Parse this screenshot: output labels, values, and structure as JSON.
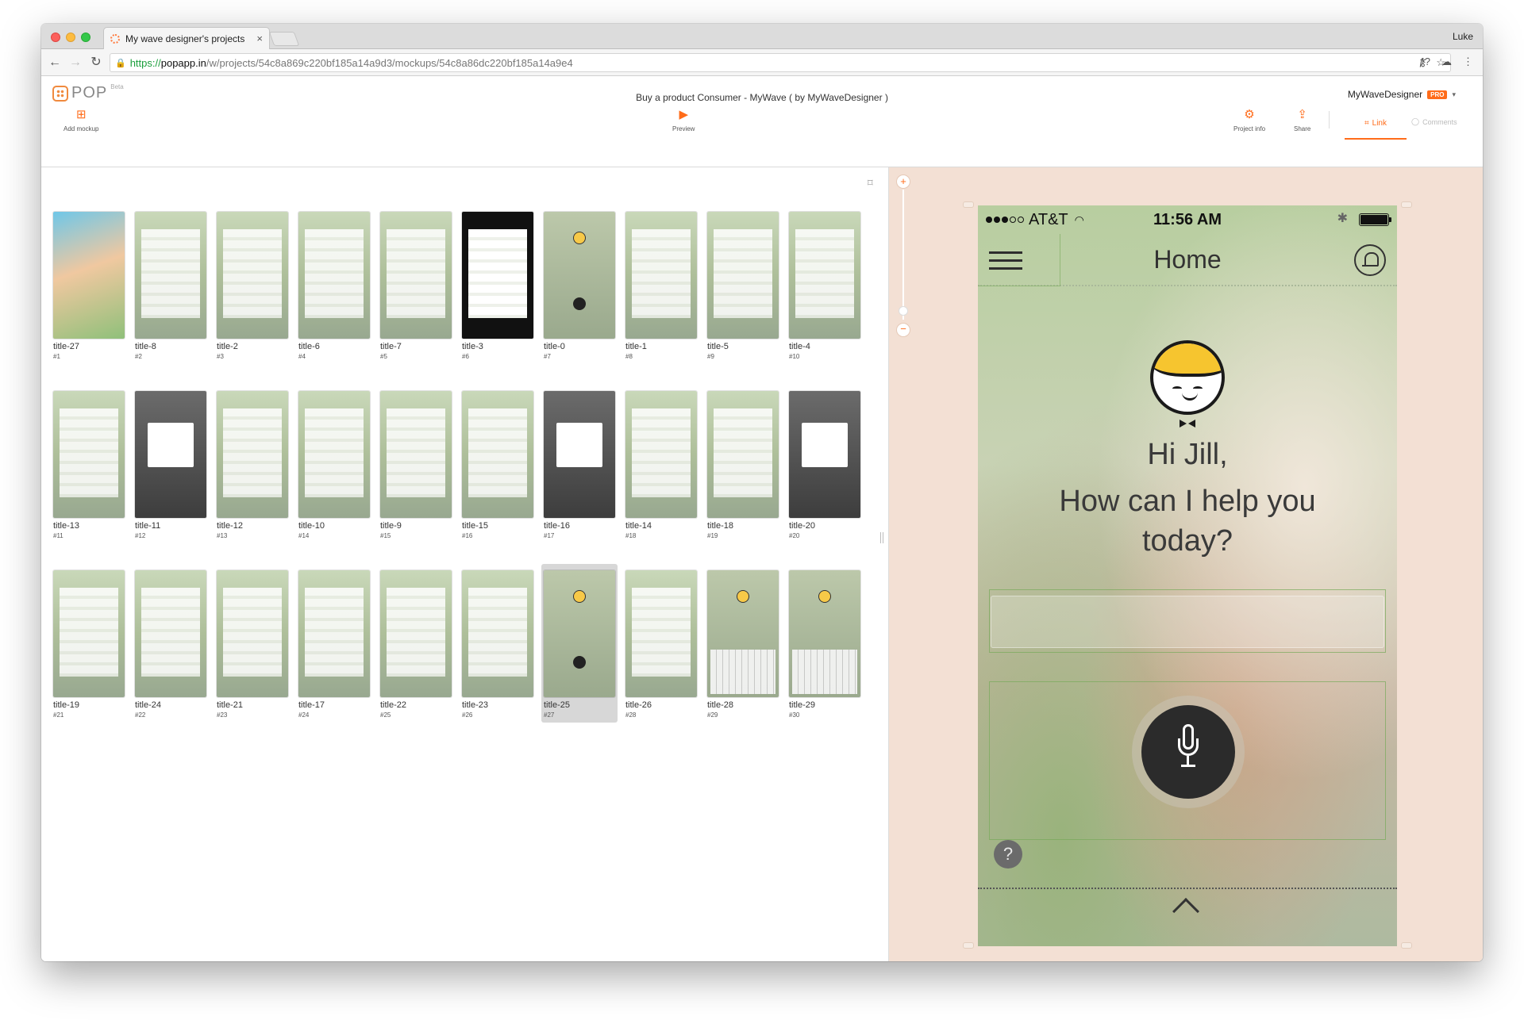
{
  "browser": {
    "tab_title": "My wave designer's projects",
    "tab_close": "×",
    "user": "Luke",
    "url_https": "https://",
    "url_host": "popapp.in",
    "url_path": "/w/projects/54c8a869c220bf185a14a9d3/mockups/54c8a86dc220bf185a14a9e4"
  },
  "app": {
    "logo": "POP",
    "beta": "Beta",
    "project_title": "Buy a product Consumer - MyWave ( by MyWaveDesigner )",
    "designer_name": "MyWaveDesigner",
    "pro_badge": "PRO",
    "add_mockup": "Add mockup",
    "preview": "Preview",
    "project_info": "Project info",
    "share": "Share",
    "link": "Link",
    "comments": "Comments"
  },
  "gallery": {
    "items": [
      {
        "label": "title-27",
        "num": "#1"
      },
      {
        "label": "title-8",
        "num": "#2"
      },
      {
        "label": "title-2",
        "num": "#3"
      },
      {
        "label": "title-6",
        "num": "#4"
      },
      {
        "label": "title-7",
        "num": "#5"
      },
      {
        "label": "title-3",
        "num": "#6"
      },
      {
        "label": "title-0",
        "num": "#7"
      },
      {
        "label": "title-1",
        "num": "#8"
      },
      {
        "label": "title-5",
        "num": "#9"
      },
      {
        "label": "title-4",
        "num": "#10"
      },
      {
        "label": "title-13",
        "num": "#11"
      },
      {
        "label": "title-11",
        "num": "#12"
      },
      {
        "label": "title-12",
        "num": "#13"
      },
      {
        "label": "title-10",
        "num": "#14"
      },
      {
        "label": "title-9",
        "num": "#15"
      },
      {
        "label": "title-15",
        "num": "#16"
      },
      {
        "label": "title-16",
        "num": "#17"
      },
      {
        "label": "title-14",
        "num": "#18"
      },
      {
        "label": "title-18",
        "num": "#19"
      },
      {
        "label": "title-20",
        "num": "#20"
      },
      {
        "label": "title-19",
        "num": "#21"
      },
      {
        "label": "title-24",
        "num": "#22"
      },
      {
        "label": "title-21",
        "num": "#23"
      },
      {
        "label": "title-17",
        "num": "#24"
      },
      {
        "label": "title-22",
        "num": "#25"
      },
      {
        "label": "title-23",
        "num": "#26"
      },
      {
        "label": "title-25",
        "num": "#27"
      },
      {
        "label": "title-26",
        "num": "#28"
      },
      {
        "label": "title-28",
        "num": "#29"
      },
      {
        "label": "title-29",
        "num": "#30"
      }
    ],
    "selected": "title-25"
  },
  "phone": {
    "carrier": "AT&T",
    "time": "11:56 AM",
    "nav_title": "Home",
    "greeting": "Hi Jill,",
    "question": "How can I help you today?",
    "help": "?"
  },
  "colors": {
    "accent": "#ff6c1a",
    "preview_bg": "#f3e0d4",
    "hotspot": "#7aaa5a"
  },
  "icons": [
    "back-icon",
    "forward-icon",
    "reload-icon",
    "lock-icon",
    "key-icon",
    "star-icon",
    "add-mockup-icon",
    "preview-play-icon",
    "gear-icon",
    "share-icon",
    "link-icon",
    "comment-icon",
    "bookmark-icon",
    "hamburger-icon",
    "bell-icon",
    "mic-icon",
    "help-icon",
    "chevron-up-icon"
  ]
}
